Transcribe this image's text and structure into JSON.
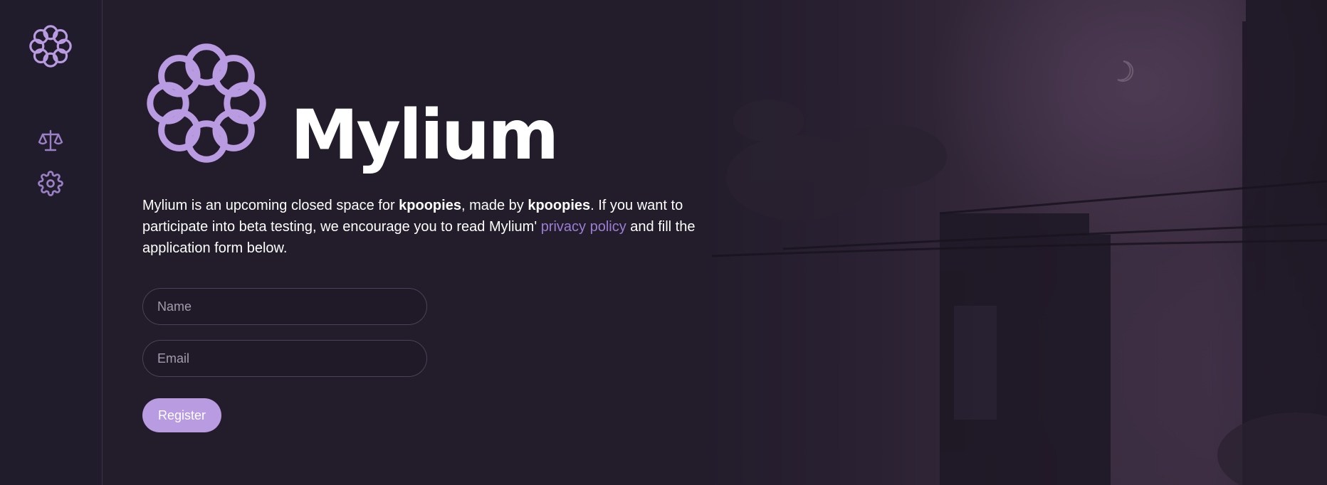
{
  "app": {
    "name": "Mylium",
    "accent_color": "#b89be0",
    "link_color": "#9b7ed3",
    "background_color": "#221c2b"
  },
  "sidebar": {
    "logo_icon": "mylium-logo-icon",
    "items": [
      {
        "icon": "scale-icon"
      },
      {
        "icon": "gear-icon"
      }
    ]
  },
  "brand": {
    "wordmark": "Mylium"
  },
  "intro": {
    "part1": "Mylium is an upcoming closed space for ",
    "author1": "kpoopies",
    "part2": ", made by ",
    "author2": "kpoopies",
    "part3": ". If you want to participate into beta testing, we encourage you to read Mylium' ",
    "link": "privacy policy",
    "part4": " and fill the application form below."
  },
  "form": {
    "name_placeholder": "Name",
    "name_value": "",
    "email_placeholder": "Email",
    "email_value": "",
    "submit_label": "Register"
  }
}
